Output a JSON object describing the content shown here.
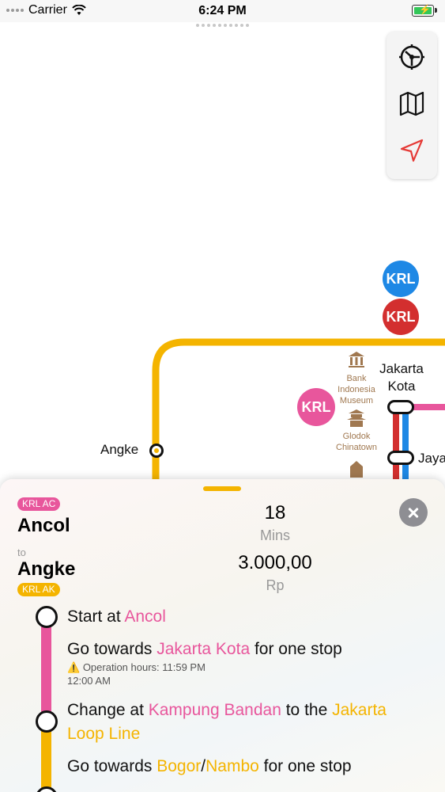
{
  "status_bar": {
    "carrier": "Carrier",
    "time": "6:24 PM"
  },
  "toolbar": {
    "icons": [
      "train-network-icon",
      "map-icon",
      "location-arrow-icon"
    ]
  },
  "map": {
    "badges": [
      {
        "label": "KRL",
        "color": "#1e88e5"
      },
      {
        "label": "KRL",
        "color": "#d32f2f"
      },
      {
        "label": "KRL",
        "color": "#e8569c"
      }
    ],
    "stations": {
      "angke": "Angke",
      "jakarta_kota_1": "Jakarta",
      "jakarta_kota_2": "Kota",
      "jaya": "Jaya"
    },
    "pois": {
      "museum": [
        "Bank",
        "Indonesia",
        "Museum"
      ],
      "chinatown": [
        "Glodok",
        "Chinatown"
      ]
    },
    "line_colors": {
      "loop": "#f4b400",
      "pink": "#e8569c",
      "red": "#d32f2f",
      "blue": "#1e88e5"
    }
  },
  "sheet": {
    "from_tag": "KRL AC",
    "from": "Ancol",
    "to_word": "to",
    "to": "Angke",
    "to_tag": "KRL AK",
    "duration": "18",
    "duration_unit": "Mins",
    "fare": "3.000,00",
    "fare_unit": "Rp",
    "steps": {
      "start_prefix": "Start at ",
      "start_station": "Ancol",
      "go1_prefix": "Go towards ",
      "go1_station": "Jakarta Kota",
      "go1_suffix": " for one stop",
      "warning_line1": "Operation hours: 11:59 PM",
      "warning_line2": "12:00 AM",
      "change_prefix": "Change at ",
      "change_station": "Kampung Bandan",
      "change_mid": " to the ",
      "change_line_a": "Jakarta",
      "change_line_b": "Loop Line",
      "go2_prefix": "Go towards ",
      "go2_station_a": "Bogor",
      "go2_sep": "/",
      "go2_station_b": "Nambo",
      "go2_suffix": " for one stop"
    }
  }
}
